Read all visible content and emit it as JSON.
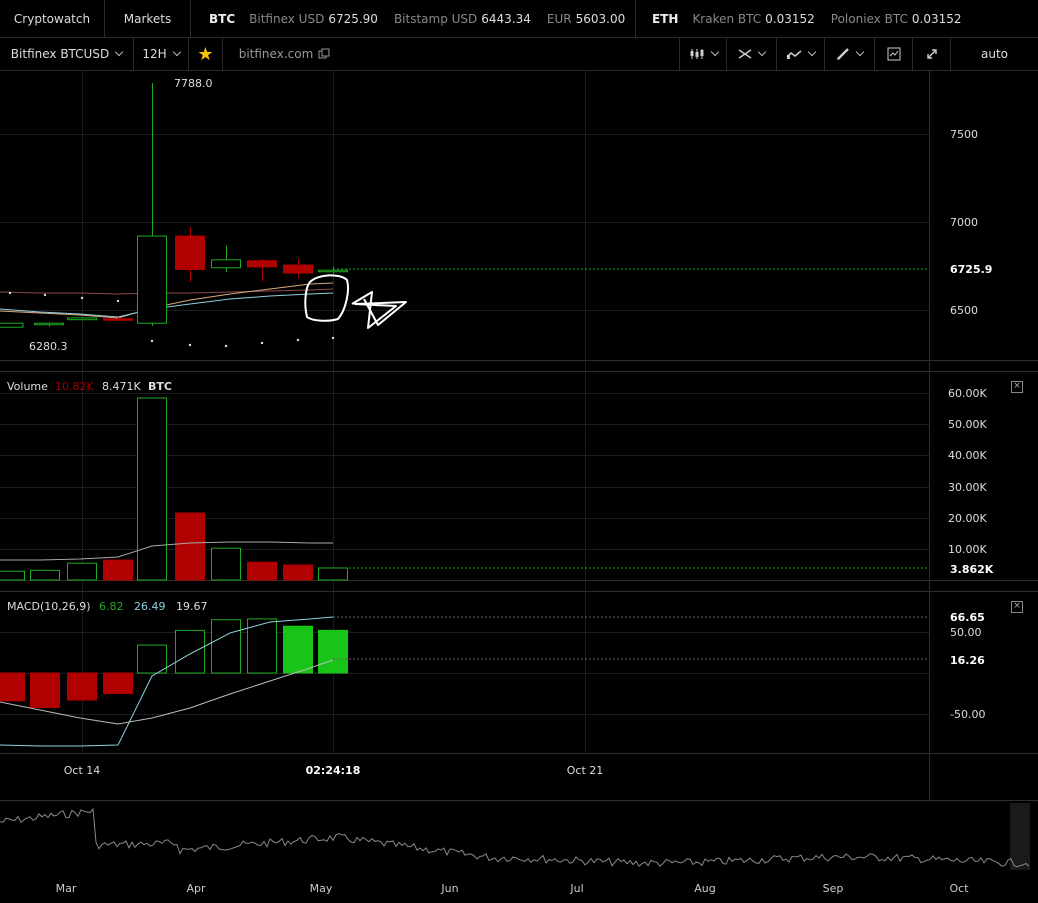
{
  "topbar": {
    "brand": "Cryptowatch",
    "markets": "Markets",
    "btc": {
      "label": "BTC",
      "tickers": [
        {
          "name": "Bitfinex USD",
          "value": "6725.90"
        },
        {
          "name": "Bitstamp USD",
          "value": "6443.34"
        },
        {
          "name": "EUR",
          "value": "5603.00"
        }
      ]
    },
    "eth": {
      "label": "ETH",
      "tickers": [
        {
          "name": "Kraken BTC",
          "value": "0.03152"
        },
        {
          "name": "Poloniex BTC",
          "value": "0.03152"
        }
      ]
    }
  },
  "toolbar": {
    "market": "Bitfinex BTCUSD",
    "period": "12H",
    "exchange_link": "bitfinex.com",
    "scale": "auto",
    "icons": [
      "candles-icon",
      "crosshair-icon",
      "indicators-icon",
      "pencil-icon",
      "chart-icon",
      "expand-icon"
    ]
  },
  "price_pane": {
    "high_label": "7788.0",
    "low_label": "6280.3",
    "current_label": "6725.9",
    "axis_ticks": [
      "7500",
      "7000",
      "6500"
    ]
  },
  "volume_pane": {
    "label": "Volume",
    "value_sell": "10.82K",
    "value_buy": "8.471K",
    "unit": "BTC",
    "current_label": "3.862K",
    "axis_ticks": [
      "60.00K",
      "50.00K",
      "40.00K",
      "30.00K",
      "20.00K",
      "10.00K"
    ]
  },
  "macd_pane": {
    "label": "MACD(10,26,9)",
    "v1": "6.82",
    "v2": "26.49",
    "v3": "19.67",
    "axis_ticks": [
      "50.00",
      "-50.00"
    ],
    "label_high": "66.65",
    "label_signal": "16.26"
  },
  "time_axis": {
    "labels": [
      "Oct 14",
      "02:24:18",
      "Oct 21"
    ]
  },
  "navigator": {
    "labels": [
      "Mar",
      "Apr",
      "May",
      "Jun",
      "Jul",
      "Aug",
      "Sep",
      "Oct"
    ]
  },
  "colors": {
    "up": "#1faa1f",
    "down": "#b10000",
    "macd_up": "#17c417",
    "background": "#000000",
    "grid": "#1d1d1d"
  },
  "chart_data": {
    "type": "candlestick",
    "candles": [
      {
        "open": 6420,
        "high": 6430,
        "low": 6405,
        "close": 6425
      },
      {
        "open": 6445,
        "high": 6460,
        "low": 6440,
        "close": 6455
      },
      {
        "open": 6450,
        "high": 6460,
        "low": 6440,
        "close": 6445
      },
      {
        "open": 6425,
        "high": 7790,
        "low": 6410,
        "close": 6920
      },
      {
        "open": 6920,
        "high": 6970,
        "low": 6660,
        "close": 6730
      },
      {
        "open": 6740,
        "high": 6865,
        "low": 6715,
        "close": 6785
      },
      {
        "open": 6780,
        "high": 6790,
        "low": 6665,
        "close": 6745
      },
      {
        "open": 6755,
        "high": 6790,
        "low": 6680,
        "close": 6710
      },
      {
        "open": 6718,
        "high": 6745,
        "low": 6705,
        "close": 6726
      }
    ],
    "volumes": [
      {
        "value": 2800,
        "dir": "up"
      },
      {
        "value": 3100,
        "dir": "up"
      },
      {
        "value": 5400,
        "dir": "up"
      },
      {
        "value": 6400,
        "dir": "down"
      },
      {
        "value": 60000,
        "dir": "up"
      },
      {
        "value": 21500,
        "dir": "down"
      },
      {
        "value": 10200,
        "dir": "up"
      },
      {
        "value": 5700,
        "dir": "down"
      },
      {
        "value": 4800,
        "dir": "down"
      },
      {
        "value": 3862,
        "dir": "up"
      }
    ],
    "macd_hist": [
      -34,
      -42,
      -33,
      -25,
      34,
      52,
      65,
      66,
      57,
      52
    ],
    "ylim": [
      6280.3,
      7788.0
    ]
  }
}
